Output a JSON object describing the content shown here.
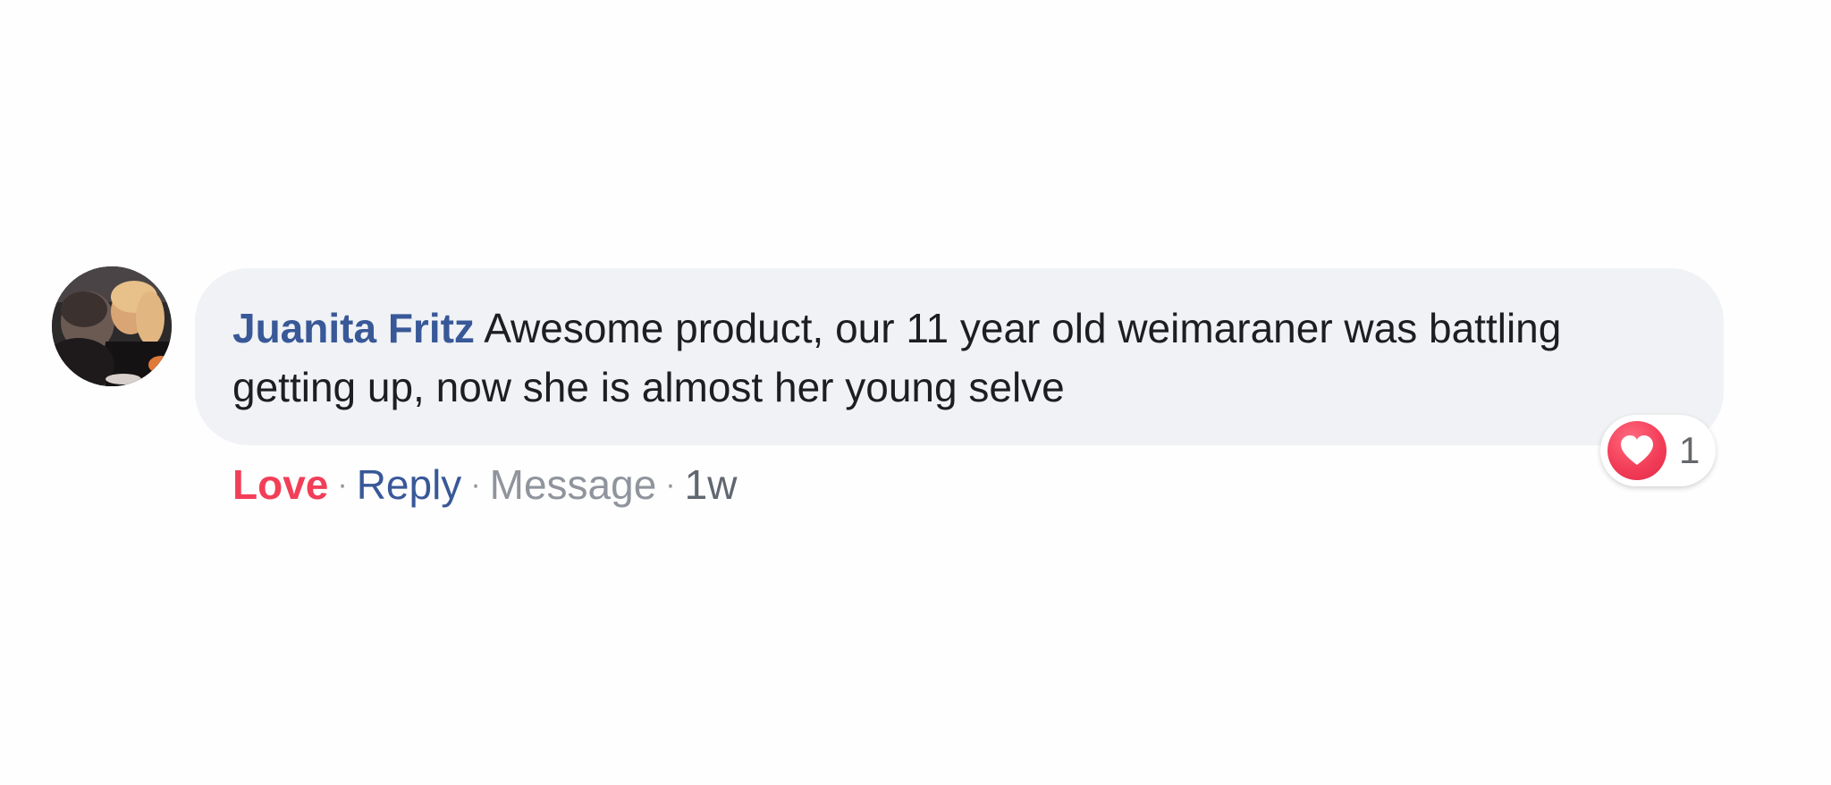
{
  "comment": {
    "author": "Juanita Fritz",
    "text": "Awesome product, our 11 year old weimaraner was battling getting up, now she is almost her young selve",
    "reaction": {
      "icon": "heart-icon",
      "color": "#f33e58",
      "count": "1"
    },
    "actions": {
      "love": "Love",
      "reply": "Reply",
      "message": "Message",
      "time": "1w",
      "separator": "·"
    }
  },
  "colors": {
    "author": "#385898",
    "love": "#f33e58",
    "bubble": "#f0f2f5",
    "muted": "#90949c"
  }
}
